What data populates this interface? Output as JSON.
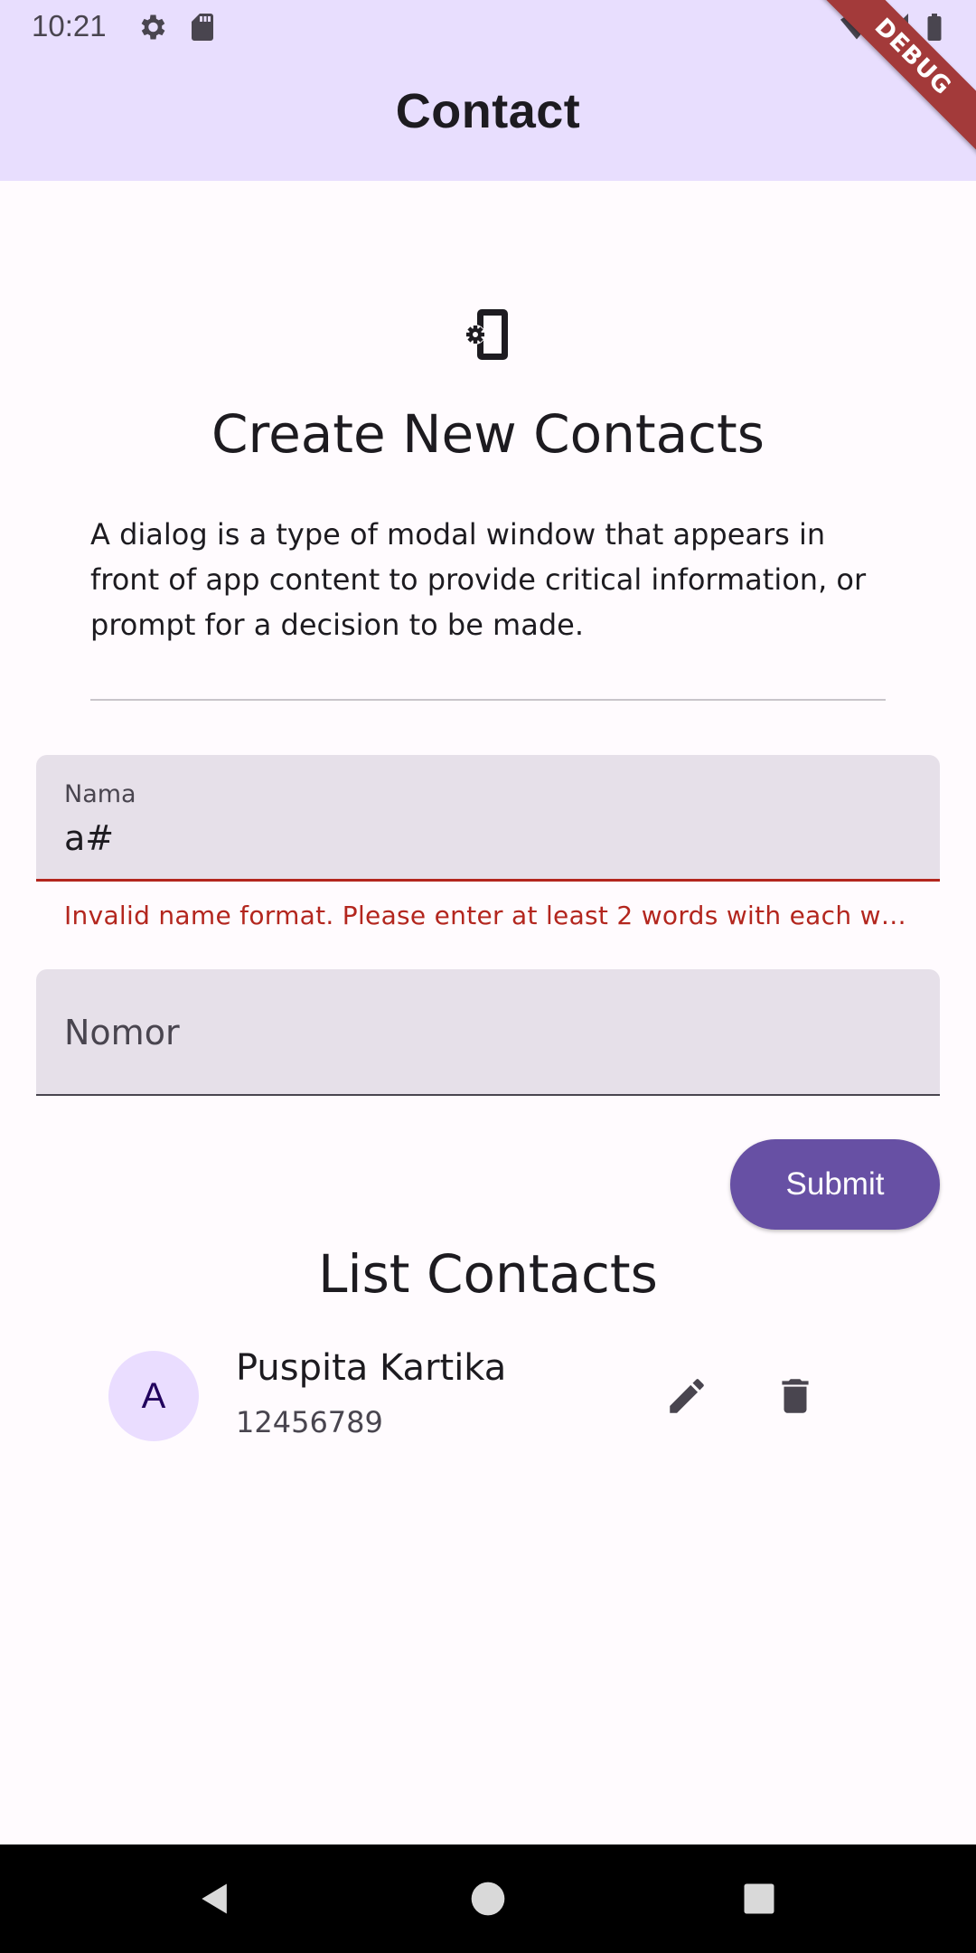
{
  "status_bar": {
    "time": "10:21",
    "icons": [
      "gear-icon",
      "sd-card-icon",
      "wifi-icon",
      "signal-icon",
      "battery-icon"
    ]
  },
  "debug_ribbon": "DEBUG",
  "app_bar": {
    "title": "Contact"
  },
  "header": {
    "icon": "phone-settings-icon",
    "title": "Create New Contacts",
    "description": "A dialog is a type of modal window that appears in front of app content to provide critical information, or prompt for a decision to be made."
  },
  "form": {
    "name_field": {
      "label": "Nama",
      "value": "a#",
      "error": "Invalid name format. Please enter at least 2 words with each wo…"
    },
    "number_field": {
      "label": "Nomor",
      "value": ""
    },
    "submit_label": "Submit"
  },
  "list": {
    "title": "List Contacts",
    "contacts": [
      {
        "avatar_letter": "A",
        "name": "Puspita Kartika",
        "number": "12456789"
      }
    ]
  },
  "colors": {
    "app_bar_bg": "#e8defe",
    "primary": "#6750a4",
    "field_bg": "#e6e0e9",
    "error": "#b3261e",
    "avatar_bg": "#eaddff"
  },
  "nav_bar": [
    "back-icon",
    "home-icon",
    "recents-icon"
  ]
}
